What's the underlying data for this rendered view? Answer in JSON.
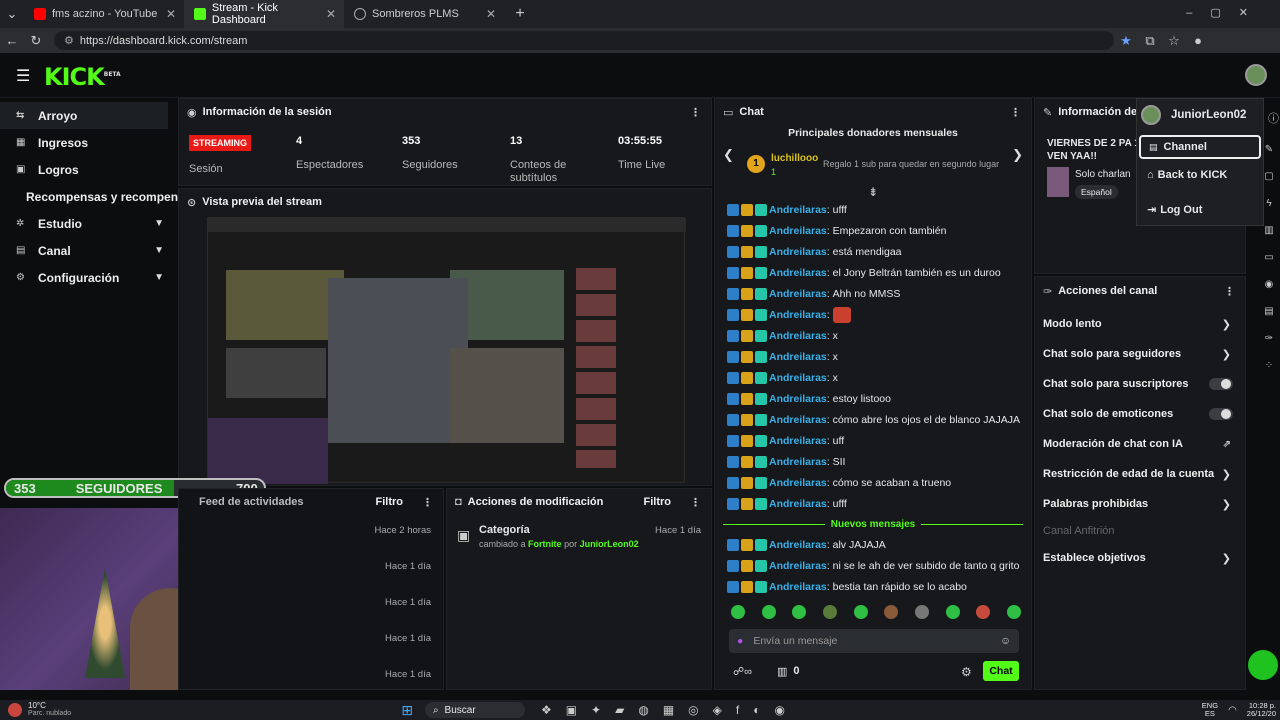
{
  "browser": {
    "tabs": [
      {
        "label": "fms aczino - YouTube"
      },
      {
        "label": "Stream - Kick Dashboard"
      },
      {
        "label": "Sombreros PLMS"
      }
    ],
    "url": "https://dashboard.kick.com/stream"
  },
  "brand": {
    "logo": "KICK",
    "beta": "BETA",
    "accent": "#53fc18"
  },
  "sidebar": {
    "items": [
      {
        "label": "Arroyo"
      },
      {
        "label": "Ingresos"
      },
      {
        "label": "Logros"
      },
      {
        "label": "Recompensas y recompensas"
      },
      {
        "label": "Estudio"
      },
      {
        "label": "Canal"
      },
      {
        "label": "Configuración"
      }
    ]
  },
  "session": {
    "title": "Información de la sesión",
    "status": "STREAMING",
    "status_label": "Sesión",
    "viewers": "4",
    "viewers_label": "Espectadores",
    "followers": "353",
    "followers_label": "Seguidores",
    "subs": "13",
    "subs_label": "Conteos de subtítulos",
    "time": "03:55:55",
    "time_label": "Time Live"
  },
  "preview": {
    "title": "Vista previa del stream"
  },
  "overlay": {
    "count": "353",
    "label": "SEGUIDORES",
    "goal": "700"
  },
  "feed": {
    "title": "Feed de actividades",
    "filter": "Filtro",
    "times": [
      "Hace 2 horas",
      "Hace 1 día",
      "Hace 1 día",
      "Hace 1 día",
      "Hace 1 día"
    ]
  },
  "mods": {
    "title": "Acciones de modificación",
    "filter": "Filtro",
    "item_title": "Categoría",
    "item_prefix": "cambiado a",
    "item_game": "Fortnite",
    "item_mid": "por",
    "item_user": "JuniorLeon02",
    "item_time": "Hace 1 día"
  },
  "chat": {
    "title": "Chat",
    "donors_title": "Principales donadores mensuales",
    "donor_name": "luchillooo",
    "donor_rank": "1",
    "donor_count": "1",
    "donor_msg": "Regalo 1 sub para quedar en segundo lugar",
    "messages": [
      {
        "user": "Andreilaras",
        "text": "ufff"
      },
      {
        "user": "Andreilaras",
        "text": "Empezaron con también"
      },
      {
        "user": "Andreilaras",
        "text": "está mendigaa"
      },
      {
        "user": "Andreilaras",
        "text": "el Jony Beltrán también es un duroo"
      },
      {
        "user": "Andreilaras",
        "text": "Ahh no MMSS"
      },
      {
        "user": "Andreilaras",
        "text": ""
      },
      {
        "user": "Andreilaras",
        "text": "x"
      },
      {
        "user": "Andreilaras",
        "text": "x"
      },
      {
        "user": "Andreilaras",
        "text": "x"
      },
      {
        "user": "Andreilaras",
        "text": "estoy listooo"
      },
      {
        "user": "Andreilaras",
        "text": "cómo abre los ojos el de blanco JAJAJA"
      },
      {
        "user": "Andreilaras",
        "text": "uff"
      },
      {
        "user": "Andreilaras",
        "text": "SII"
      },
      {
        "user": "Andreilaras",
        "text": "cómo se acaban a trueno"
      },
      {
        "user": "Andreilaras",
        "text": "ufff"
      }
    ],
    "new_label": "Nuevos mensajes",
    "new_messages": [
      {
        "user": "Andreilaras",
        "text": "alv JAJAJA"
      },
      {
        "user": "Andreilaras",
        "text": "ni se le ah de ver subido de tanto q grito"
      },
      {
        "user": "Andreilaras",
        "text": "bestia tan rápido se lo acabo"
      }
    ],
    "input_placeholder": "Envía un mensaje",
    "count": "0",
    "send": "Chat"
  },
  "stream_info": {
    "title": "Información del",
    "stream_title": "VIERNES DE 2 PA 1 VEN YAA!!",
    "category": "Solo charlan",
    "tag": "Español"
  },
  "user_menu": {
    "username": "JuniorLeon02",
    "items": [
      "Channel",
      "Back to KICK",
      "Log Out"
    ]
  },
  "channel_actions": {
    "title": "Acciones del canal",
    "items": [
      {
        "label": "Modo lento",
        "kind": "arrow"
      },
      {
        "label": "Chat solo para seguidores",
        "kind": "arrow"
      },
      {
        "label": "Chat solo para suscriptores",
        "kind": "toggle"
      },
      {
        "label": "Chat solo de emoticones",
        "kind": "toggle"
      },
      {
        "label": "Moderación de chat con IA",
        "kind": "external"
      },
      {
        "label": "Restricción de edad de la cuenta",
        "kind": "arrow"
      },
      {
        "label": "Palabras prohibidas",
        "kind": "arrow"
      }
    ],
    "host_label": "Canal Anfitrión",
    "goals_label": "Establece objetivos"
  },
  "taskbar": {
    "weather_temp": "10°C",
    "weather_desc": "Parc. nublado",
    "search": "Buscar",
    "lang": "ENG",
    "region": "ES",
    "time": "10:28 p.",
    "date": "26/12/20"
  }
}
